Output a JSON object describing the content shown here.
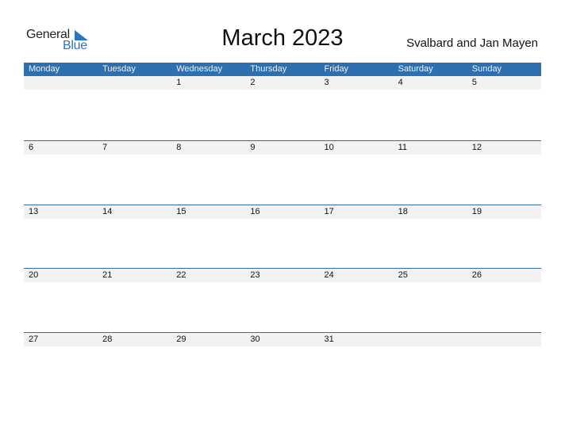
{
  "logo": {
    "line1": "General",
    "line2": "Blue"
  },
  "title": "March 2023",
  "region": "Svalbard and Jan Mayen",
  "colors": {
    "accent": "#2e6fb0",
    "strip": "#f2f2f2"
  },
  "weekdays": [
    "Monday",
    "Tuesday",
    "Wednesday",
    "Thursday",
    "Friday",
    "Saturday",
    "Sunday"
  ],
  "weeks": [
    [
      "",
      "",
      "1",
      "2",
      "3",
      "4",
      "5"
    ],
    [
      "6",
      "7",
      "8",
      "9",
      "10",
      "11",
      "12"
    ],
    [
      "13",
      "14",
      "15",
      "16",
      "17",
      "18",
      "19"
    ],
    [
      "20",
      "21",
      "22",
      "23",
      "24",
      "25",
      "26"
    ],
    [
      "27",
      "28",
      "29",
      "30",
      "31",
      "",
      ""
    ]
  ]
}
